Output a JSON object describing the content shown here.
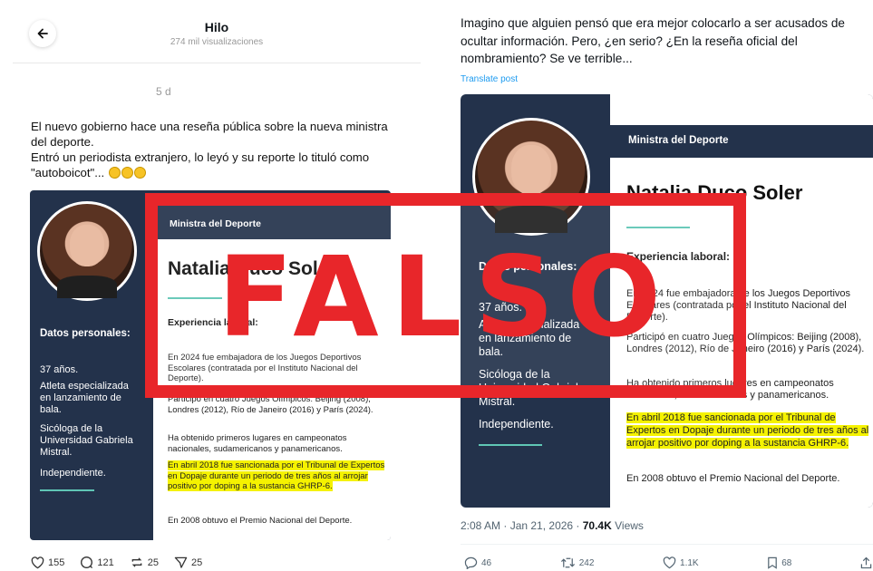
{
  "left": {
    "header": {
      "title": "Hilo",
      "subtitle": "274 mil visualizaciones"
    },
    "time_ago": "5 d",
    "post_lines": [
      "El nuevo gobierno hace una reseña pública sobre la nueva ministra",
      "del deporte.",
      "Entró un periodista extranjero, lo leyó y su reporte lo tituló como",
      "\"autoboicot\"..."
    ],
    "actions": {
      "likes": "155",
      "comments": "121",
      "reposts": "25",
      "shares": "25"
    }
  },
  "right": {
    "post_lines": [
      "Imagino que alguien pensó que era mejor colocarlo a ser acusados de",
      "ocultar información. Pero, ¿en serio? ¿En la reseña oficial del",
      "nombramiento? Se ve terrible..."
    ],
    "translate": "Translate post",
    "meta": {
      "time": "2:08 AM · Jan 21, 2026 · ",
      "views": "70.4K",
      "views_label": " Views"
    },
    "actions": {
      "replies": "46",
      "reposts": "242",
      "likes": "1.1K",
      "bookmarks": "68"
    }
  },
  "card": {
    "role": "Ministra del Deporte",
    "name": "Natalia Duco Soler",
    "side_title": "Datos personales:",
    "side_items": [
      "37 años.",
      "Atleta especializada en lanzamiento de bala.",
      "Sicóloga de la Universidad Gabriela Mistral.",
      "Independiente."
    ],
    "experience_title": "Experiencia laboral:",
    "paragraphs": [
      "En 2024 fue embajadora de los Juegos Deportivos Escolares (contratada por el Instituto Nacional del Deporte).",
      "Participó en cuatro Juegos Olímpicos: Beijing (2008), Londres (2012), Río de Janeiro (2016) y París (2024).",
      "Ha obtenido primeros lugares en campeonatos nacionales, sudamericanos y panamericanos."
    ],
    "highlight": "En abril 2018 fue sancionada por el Tribunal de Expertos en Dopaje durante un periodo de tres años al arrojar positivo por doping a la sustancia GHRP-6.",
    "last": "En 2008 obtuvo el Premio Nacional del Deporte."
  },
  "stamp": {
    "text": "FALSO",
    "color": "#e8262a"
  },
  "colors": {
    "card_navy": "#23324b",
    "accent_teal": "#5fc6b5",
    "highlight": "#f5f200",
    "link_blue": "#1d9bf0"
  }
}
